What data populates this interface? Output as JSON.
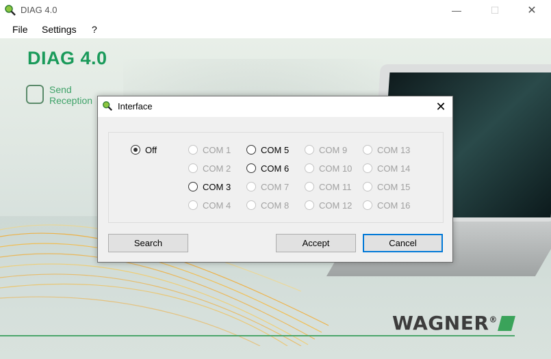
{
  "window": {
    "title": "DIAG 4.0",
    "minimize": "—",
    "maximize": "☐",
    "close": "✕"
  },
  "menu": {
    "items": [
      "File",
      "Settings",
      "?"
    ]
  },
  "app": {
    "title": "DIAG 4.0",
    "send_reception": [
      "Send",
      "Reception"
    ],
    "brand": "WAGNER",
    "brand_reg": "®"
  },
  "dialog": {
    "title": "Interface",
    "close": "✕",
    "options": {
      "off": {
        "label": "Off",
        "checked": true,
        "enabled": true
      },
      "ports": [
        {
          "label": "COM 1",
          "enabled": false
        },
        {
          "label": "COM 2",
          "enabled": false
        },
        {
          "label": "COM 3",
          "enabled": true
        },
        {
          "label": "COM 4",
          "enabled": false
        },
        {
          "label": "COM 5",
          "enabled": true
        },
        {
          "label": "COM 6",
          "enabled": true
        },
        {
          "label": "COM 7",
          "enabled": false
        },
        {
          "label": "COM 8",
          "enabled": false
        },
        {
          "label": "COM 9",
          "enabled": false
        },
        {
          "label": "COM 10",
          "enabled": false
        },
        {
          "label": "COM 11",
          "enabled": false
        },
        {
          "label": "COM 12",
          "enabled": false
        },
        {
          "label": "COM 13",
          "enabled": false
        },
        {
          "label": "COM 14",
          "enabled": false
        },
        {
          "label": "COM 15",
          "enabled": false
        },
        {
          "label": "COM 16",
          "enabled": false
        }
      ]
    },
    "buttons": {
      "search": "Search",
      "accept": "Accept",
      "cancel": "Cancel"
    }
  },
  "colors": {
    "brand_green": "#1a9a5a",
    "focus_blue": "#0078d7"
  }
}
